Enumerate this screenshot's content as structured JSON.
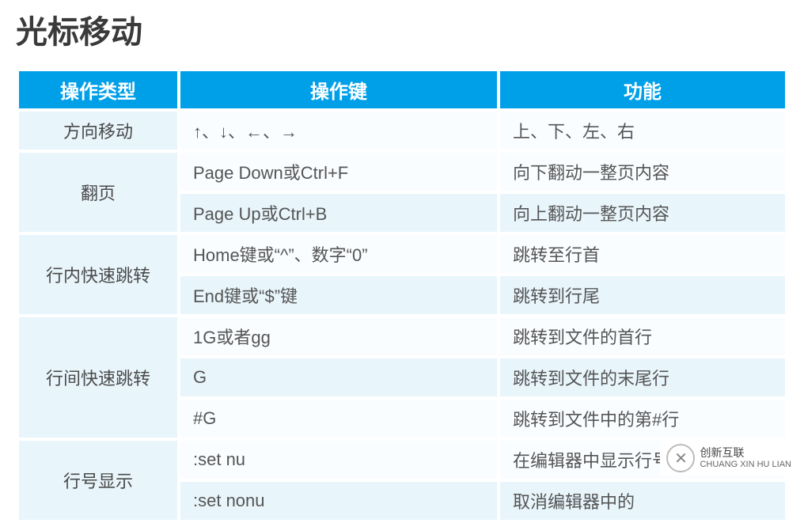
{
  "title": "光标移动",
  "headers": {
    "type": "操作类型",
    "key": "操作键",
    "func": "功能"
  },
  "rows": [
    {
      "type": "方向移动",
      "key": "↑、↓、←、→",
      "func": "上、下、左、右"
    },
    {
      "type": "翻页",
      "key": "Page Down或Ctrl+F",
      "func": "向下翻动一整页内容"
    },
    {
      "type": null,
      "key": "Page Up或Ctrl+B",
      "func": "向上翻动一整页内容"
    },
    {
      "type": "行内快速跳转",
      "key": "Home键或“^”、数字“0”",
      "func": "跳转至行首"
    },
    {
      "type": null,
      "key": "End键或“$”键",
      "func": "跳转到行尾"
    },
    {
      "type": "行间快速跳转",
      "key": "1G或者gg",
      "func": "跳转到文件的首行"
    },
    {
      "type": null,
      "key": "G",
      "func": "跳转到文件的末尾行"
    },
    {
      "type": null,
      "key": "#G",
      "func": "跳转到文件中的第#行"
    },
    {
      "type": "行号显示",
      "key": ":set nu",
      "func": "在编辑器中显示行号"
    },
    {
      "type": null,
      "key": ":set nonu",
      "func": "取消编辑器中的"
    }
  ],
  "row_groups": [
    {
      "start": 0,
      "span": 1
    },
    {
      "start": 1,
      "span": 2
    },
    {
      "start": 3,
      "span": 2
    },
    {
      "start": 5,
      "span": 3
    },
    {
      "start": 8,
      "span": 2
    }
  ],
  "logo": {
    "cn": "创新互联",
    "en": "CHUANG XIN HU LIAN"
  }
}
